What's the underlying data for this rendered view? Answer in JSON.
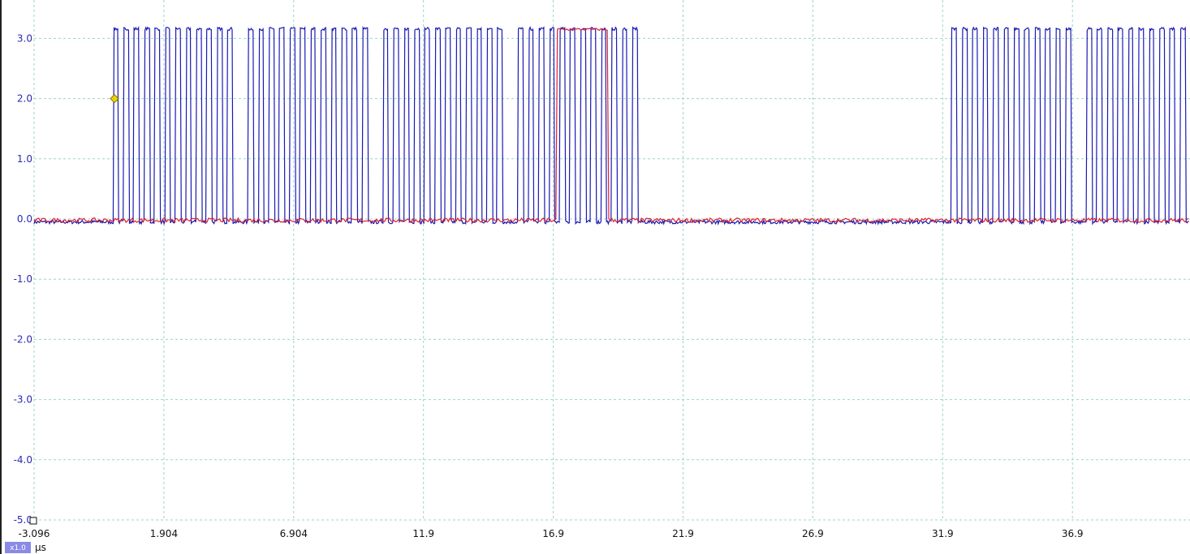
{
  "chart_data": {
    "type": "line",
    "x_unit": "μs",
    "x_ticks": [
      "-3.096",
      "1.904",
      "6.904",
      "11.9",
      "16.9",
      "21.9",
      "26.9",
      "31.9",
      "36.9"
    ],
    "y_ticks": [
      "3.0",
      "2.0",
      "1.0",
      "0.0",
      "-1.0",
      "-2.0",
      "-3.0",
      "-4.0",
      "-5.0"
    ],
    "xlim": [
      -3.096,
      41.4
    ],
    "ylim": [
      -5.0,
      3.3
    ],
    "grid": true,
    "zoom_label": "x1.0",
    "trigger_marker": {
      "x": 0.0,
      "y": 2.0,
      "color": "#e8d400"
    },
    "series": [
      {
        "color": "#1a1ab4",
        "low": -0.05,
        "high": 3.16,
        "bursts": [
          {
            "start": -0.05,
            "edges": 12,
            "period": 0.25
          },
          {
            "start": 5.15,
            "edges": 12,
            "period": 0.25
          },
          {
            "start": 10.35,
            "edges": 12,
            "period": 0.25
          },
          {
            "start": 15.55,
            "edges": 12,
            "period": 0.25
          },
          {
            "start": 32.25,
            "edges": 12,
            "period": 0.25
          },
          {
            "start": 37.45,
            "edges": 12,
            "period": 0.25
          }
        ]
      },
      {
        "color": "#e0202a",
        "low": -0.02,
        "high": 3.15,
        "pulses": [
          {
            "start": 17.05,
            "end": 19.0
          }
        ]
      }
    ]
  }
}
